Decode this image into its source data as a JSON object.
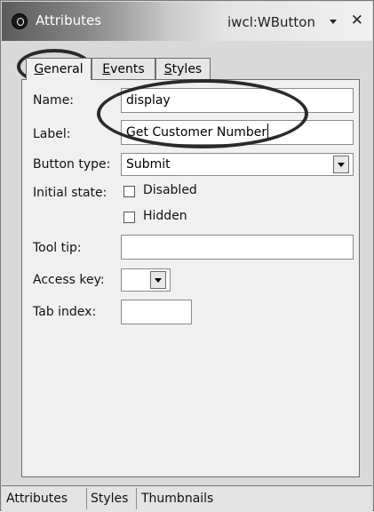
{
  "window": {
    "title": "Attributes",
    "element_id": "iwcl:WButton",
    "title_icon": "attributes-icon",
    "menu_icon": "dropdown-triangle-icon",
    "close_icon": "close-icon",
    "close_glyph": "✕"
  },
  "tabs": [
    {
      "label_first": "G",
      "label_rest": "eneral",
      "active": true
    },
    {
      "label_first": "E",
      "label_rest": "vents",
      "active": false
    },
    {
      "label_first": "S",
      "label_rest": "tyles",
      "active": false
    }
  ],
  "form": {
    "name_label": "Name:",
    "name_value": "display",
    "label_label": "Label:",
    "label_value": "Get Customer Number",
    "button_type_label": "Button type:",
    "button_type_value": "Submit",
    "initial_state_label": "Initial state:",
    "disabled_label": "Disabled",
    "disabled_checked": false,
    "hidden_label": "Hidden",
    "hidden_checked": false,
    "tooltip_label": "Tool tip:",
    "tooltip_value": "",
    "access_key_label": "Access key:",
    "access_key_value": "",
    "tab_index_label": "Tab index:",
    "tab_index_value": ""
  },
  "bottom_tabs": [
    "Attributes",
    "Styles",
    "Thumbnails"
  ],
  "colors": {
    "annotation_ink": "#2a2a2a",
    "panel_bg": "#f0f0f0",
    "title_gradient_dark": "#5b5b5b"
  }
}
